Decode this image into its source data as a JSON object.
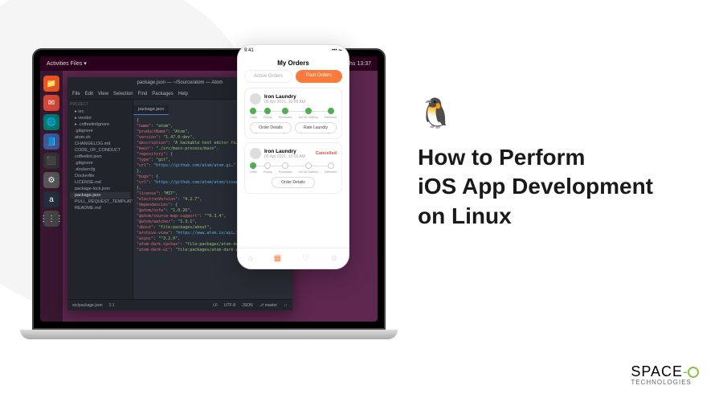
{
  "ubuntu": {
    "topbar_left": "Activities    Files ▾",
    "topbar_time": "Thu 13:37",
    "dock": [
      "📁",
      "✉",
      "🌐",
      "📘",
      "⬛",
      "⚙",
      "a",
      "⋮⋮⋮"
    ]
  },
  "atom": {
    "title": "package.json — ~/Source/atom — Atom",
    "menu": [
      "File",
      "Edit",
      "View",
      "Selection",
      "Find",
      "Packages",
      "Help"
    ],
    "tree_header": "Project",
    "tree_tab": "package.json",
    "tree": [
      "▸ src",
      "▸ vendor",
      "▸ .coffeelintignore",
      ".gitignore",
      "atom.sh",
      "CHANGELOG.md",
      "CODE_OF_CONDUCT",
      "coffeelint.json",
      ".gitignore",
      ".dockercfg",
      "Dockerfile",
      "LICENSE.md",
      "package-lock.json",
      "package.json",
      "PULL_REQUEST_TEMPLATE",
      "README.md"
    ],
    "code_lines": [
      {
        "p": [
          "{"
        ]
      },
      {
        "p": [
          "  ",
          "\"name\"",
          ": ",
          "\"atom\"",
          ","
        ]
      },
      {
        "p": [
          "  ",
          "\"productName\"",
          ": ",
          "\"Atom\"",
          ","
        ]
      },
      {
        "p": [
          "  ",
          "\"version\"",
          ": ",
          "\"1.47.0-dev\"",
          ","
        ]
      },
      {
        "p": [
          "  ",
          "\"description\"",
          ": ",
          "\"A hackable text editor fo…\"",
          ","
        ]
      },
      {
        "p": [
          "  ",
          "\"main\"",
          ": ",
          "\"./src/main-process/main\"",
          ","
        ]
      },
      {
        "p": [
          "  ",
          "\"repository\"",
          ": {"
        ]
      },
      {
        "p": [
          "    ",
          "\"type\"",
          ": ",
          "\"git\"",
          ","
        ]
      },
      {
        "p": [
          "    ",
          "\"url\"",
          ": ",
          "\"https://github.com/atom/atom.gi…\""
        ]
      },
      {
        "p": [
          "  },"
        ]
      },
      {
        "p": [
          "  ",
          "\"bugs\"",
          ": {"
        ]
      },
      {
        "p": [
          "    ",
          "\"url\"",
          ": ",
          "\"https://github.com/atom/atom/issues\""
        ]
      },
      {
        "p": [
          "  },"
        ]
      },
      {
        "p": [
          "  ",
          "\"license\"",
          ": ",
          "\"MIT\"",
          ","
        ]
      },
      {
        "p": [
          "  ",
          "\"electronVersion\"",
          ": ",
          "\"4.2.7\"",
          ","
        ]
      },
      {
        "p": [
          "  ",
          "\"dependencies\"",
          ": {"
        ]
      },
      {
        "p": [
          "    ",
          "\"@atom/nsfw\"",
          ": ",
          "\"1.0.26\"",
          ","
        ]
      },
      {
        "p": [
          "    ",
          "\"@atom/source-map-support\"",
          ": ",
          "\"^0.3.4\"",
          ","
        ]
      },
      {
        "p": [
          "    ",
          "\"@atom/watcher\"",
          ": ",
          "\"1.3.1\"",
          ","
        ]
      },
      {
        "p": [
          "    ",
          "\"about\"",
          ": ",
          "\"file:packages/about\"",
          ","
        ]
      },
      {
        "p": [
          "    ",
          "\"archive-view\"",
          ": ",
          "\"https://www.atom.io/api…\"",
          ","
        ]
      },
      {
        "p": [
          "    ",
          "\"async\"",
          ": ",
          "\"^3.2.0\"",
          ","
        ]
      },
      {
        "p": [
          "    ",
          "\"atom-dark-syntax\"",
          ": ",
          "\"file:packages/atom-dark…\"",
          ","
        ]
      },
      {
        "p": [
          "    ",
          "\"atom-dark-ui\"",
          ": ",
          "\"file:packages/atom-dark-ui\""
        ]
      }
    ],
    "status_left": [
      "src/package.json",
      "1:1"
    ],
    "status_right": [
      "LF",
      "UTF-8",
      "JSON",
      "⎇ master",
      "↓↑"
    ]
  },
  "phone": {
    "time": "9:41",
    "signal": "••• ⏦",
    "title": "My Orders",
    "tabs": {
      "inactive": "Active Orders",
      "active": "Past Orders"
    },
    "steps": [
      "Order",
      "Pickup",
      "Processed",
      "Out for Delivery",
      "Delivered"
    ],
    "order1": {
      "name": "Iron Laundry",
      "date": "05 Apr 2021, 10:00 AM",
      "btn1": "Order Details",
      "btn2": "Rate Laundry"
    },
    "order2": {
      "name": "Iron Laundry",
      "date": "05 Apr 2021, 10:00 AM",
      "status": "Cancelled",
      "btn1": "Order Details"
    }
  },
  "headline": {
    "l1": "How to Perform",
    "l2": "iOS App Development",
    "l3": "on Linux"
  },
  "logo": {
    "text1": "SPACE",
    "text2": "TECHNOLOGIES"
  }
}
